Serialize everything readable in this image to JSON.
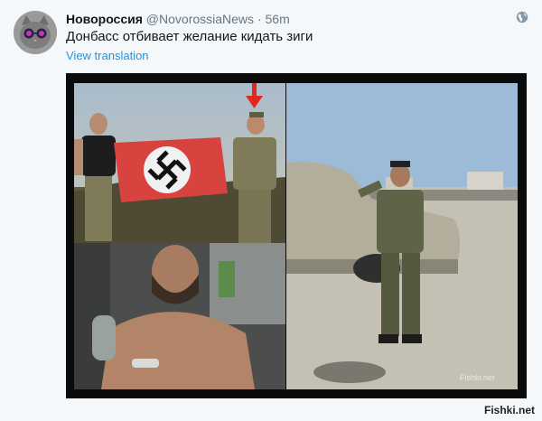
{
  "tweet": {
    "display_name": "Новороссия",
    "handle": "@NovorossiaNews",
    "separator": "·",
    "time": "56m",
    "text": "Донбасс отбивает желание кидать зиги",
    "translate_link": "View translation"
  },
  "media": {
    "watermark": "Fishki.net"
  },
  "site_watermark": "Fishki.net",
  "colors": {
    "background": "#f5f8fa",
    "link": "#1b95e0",
    "handle": "#657786",
    "flag_red": "#d8433f",
    "arrow_red": "#e0281f"
  },
  "icons": {
    "avatar": "cat-avatar",
    "globe": "globe-icon",
    "arrow": "arrow-down-icon"
  }
}
